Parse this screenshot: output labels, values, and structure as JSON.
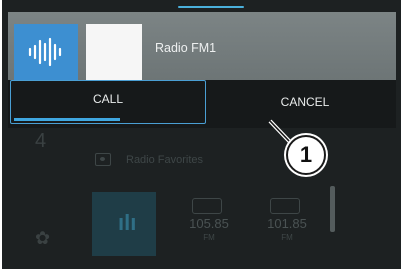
{
  "notification": {
    "station_name": "Radio FM1",
    "app_icon": "waveform-icon",
    "call_label": "CALL",
    "cancel_label": "CANCEL",
    "call_progress": 0.55,
    "accent_color": "#3fa7e0"
  },
  "background_app": {
    "left_digit": "4",
    "favorites_header": "Radio Favorites",
    "presets": [
      {
        "frequency": "105.85",
        "band": "FM"
      },
      {
        "frequency": "101.85",
        "band": "FM"
      }
    ]
  },
  "callout": {
    "number": "1"
  }
}
